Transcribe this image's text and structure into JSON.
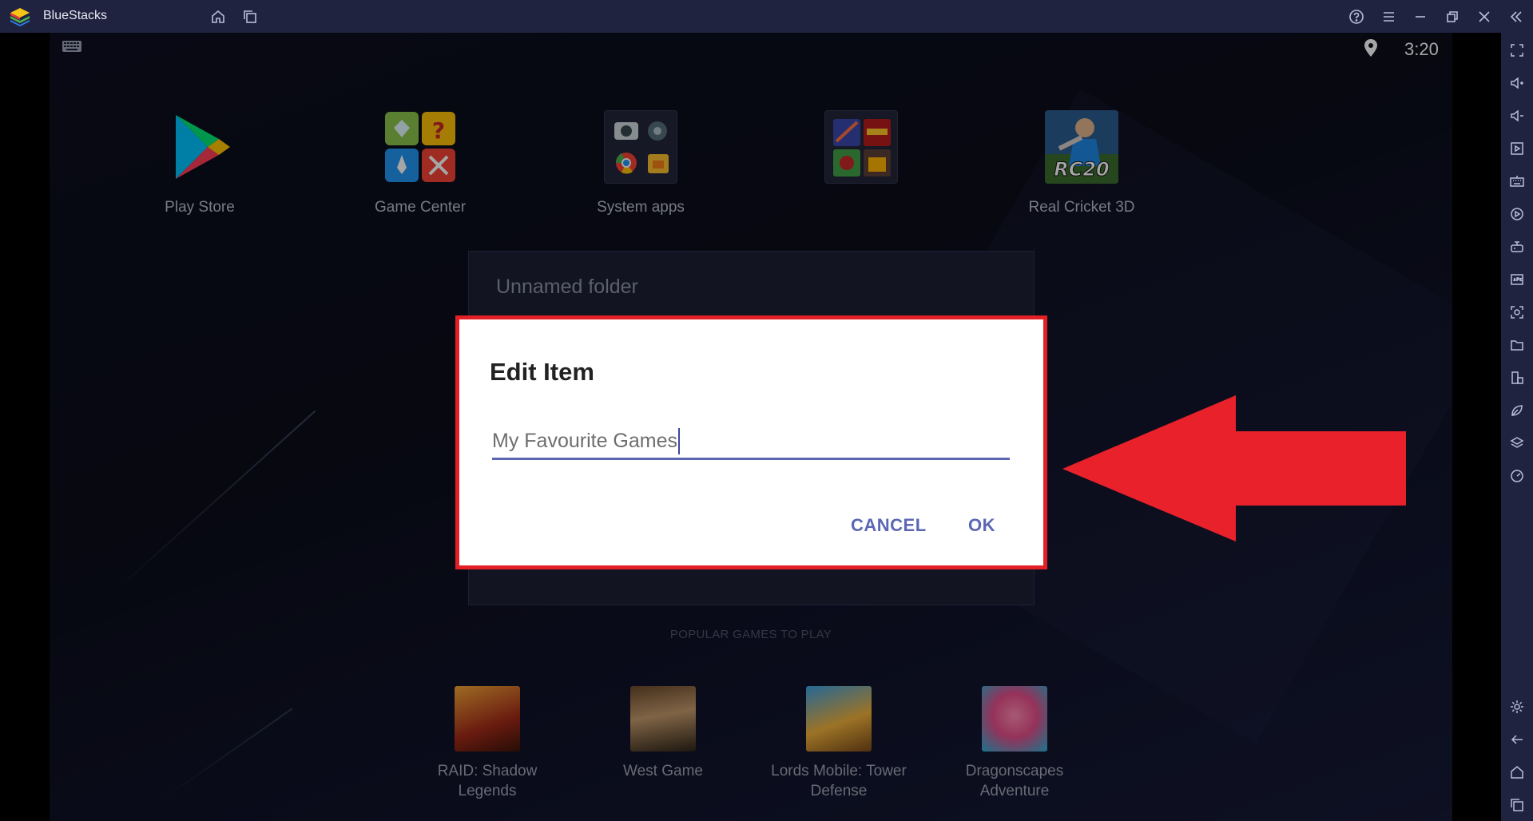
{
  "window": {
    "title": "BlueStacks"
  },
  "statusbar": {
    "time": "3:20"
  },
  "home": {
    "apps": [
      {
        "label": "Play Store"
      },
      {
        "label": "Game Center"
      },
      {
        "label": "System apps"
      },
      {
        "label": ""
      },
      {
        "label": "Real Cricket 3D",
        "badge": "RC20"
      }
    ],
    "folder_title": "Unnamed folder",
    "popular_heading": "POPULAR GAMES TO PLAY",
    "games": [
      {
        "label": "RAID: Shadow Legends"
      },
      {
        "label": "West Game"
      },
      {
        "label": "Lords Mobile: Tower Defense"
      },
      {
        "label": "Dragonscapes Adventure"
      }
    ]
  },
  "dialog": {
    "title": "Edit Item",
    "input_value": "My Favourite Games",
    "cancel_label": "CANCEL",
    "ok_label": "OK"
  },
  "colors": {
    "highlight_border": "#e42027",
    "accent": "#5b67b5",
    "chrome": "#1f2340"
  },
  "icons": {
    "titlebar": [
      "home-icon",
      "multi-instance-icon",
      "help-icon",
      "menu-icon",
      "minimize-icon",
      "restore-icon",
      "close-icon",
      "collapse-sidebar-icon"
    ],
    "sidebar": [
      "fullscreen-icon",
      "volume-up-icon",
      "volume-down-icon",
      "media-icon",
      "keyboard-controls-icon",
      "macro-icon",
      "game-controls-icon",
      "apk-install-icon",
      "screenshot-icon",
      "folder-icon",
      "multi-instance-icon",
      "eco-mode-icon",
      "layers-icon",
      "performance-icon",
      "settings-icon",
      "back-icon",
      "home-icon",
      "recent-apps-icon"
    ]
  }
}
